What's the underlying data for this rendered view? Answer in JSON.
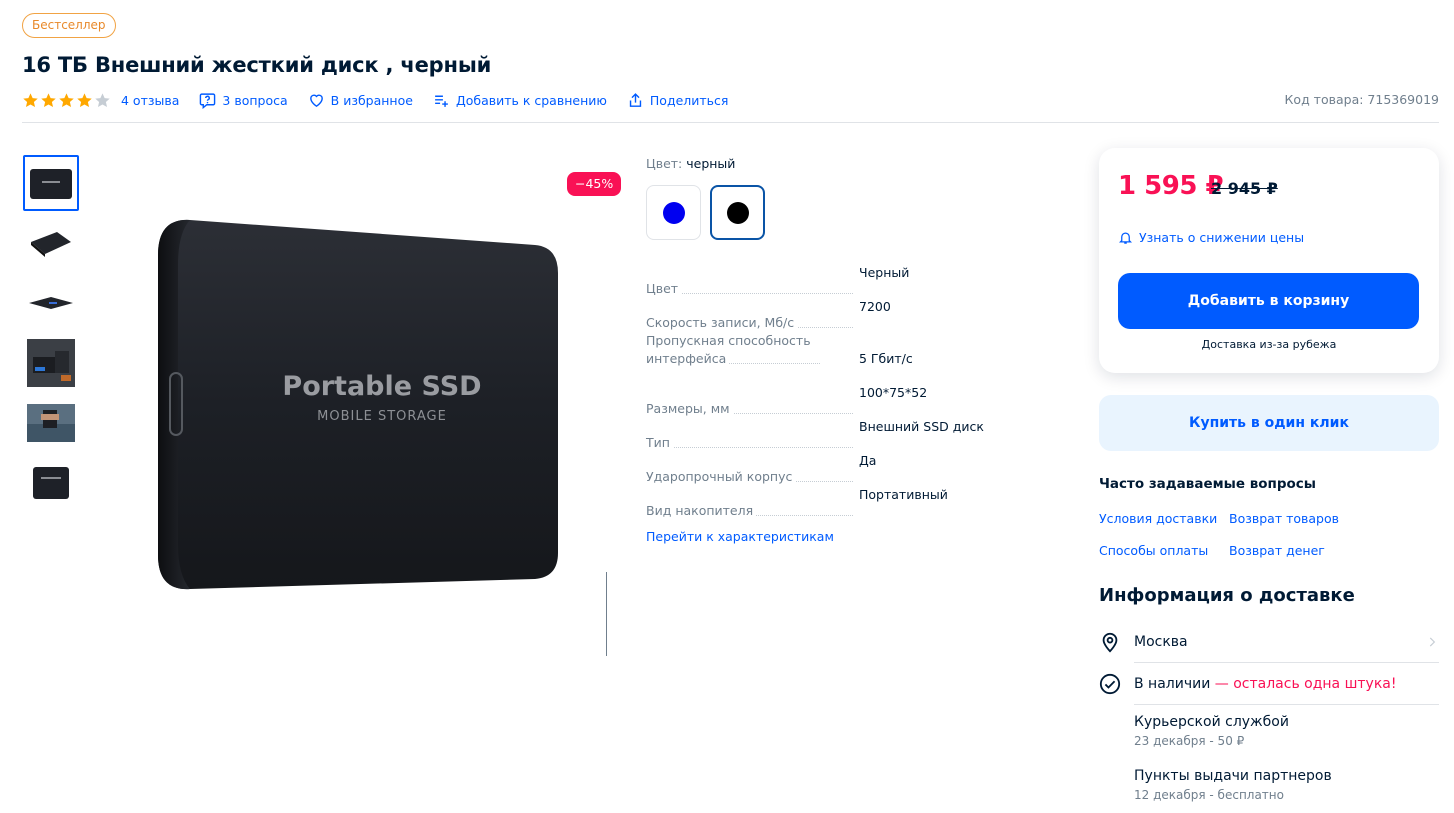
{
  "badge": "Бестселлер",
  "title": "16 ТБ Внешний жесткий диск , черный",
  "rating": {
    "stars": 4,
    "max": 5
  },
  "meta": {
    "reviews": "4 отзыва",
    "questions": "3 вопроса",
    "favorite": "В избранное",
    "compare": "Добавить к сравнению",
    "share": "Поделиться",
    "sku": "Код товара: 715369019"
  },
  "gallery": {
    "discount": "−45%",
    "product_text_line1": "Portable SSD",
    "product_text_line2": "MOBILE STORAGE"
  },
  "color": {
    "label": "Цвет:",
    "value": "черный",
    "options": [
      "#0000f0",
      "#000000"
    ]
  },
  "specs": [
    {
      "key": "Цвет",
      "value": "Черный"
    },
    {
      "key": "Скорость записи, Мб/с",
      "value": "7200"
    },
    {
      "key": "Пропускная способность интерфейса",
      "value": "5 Гбит/с"
    },
    {
      "key": "Размеры, мм",
      "value": "100*75*52"
    },
    {
      "key": "Тип",
      "value": "Внешний SSD диск"
    },
    {
      "key": "Ударопрочный корпус",
      "value": "Да"
    },
    {
      "key": "Вид накопителя",
      "value": "Портативный"
    }
  ],
  "to_specs": "Перейти к характеристикам",
  "price": {
    "current": "1 595 ₽",
    "old": "2 945 ₽",
    "notify": "Узнать о снижении цены",
    "cart": "Добавить в корзину",
    "abroad": "Доставка из-за рубежа",
    "one_click": "Купить в один клик"
  },
  "faq": {
    "title": "Часто задаваемые вопросы",
    "links": [
      "Условия доставки",
      "Возврат товаров",
      "Способы оплаты",
      "Возврат денег"
    ]
  },
  "delivery": {
    "title": "Информация о доставке",
    "city": "Москва",
    "stock": "В наличии",
    "stock_note": "— осталась одна штука!",
    "options": [
      {
        "name": "Курьерской службой",
        "sub": "23 декабря - 50 ₽"
      },
      {
        "name": "Пункты выдачи партнеров",
        "sub": "12 декабря - бесплатно"
      }
    ]
  },
  "colors": {
    "accent": "#005bff",
    "sale": "#f91155",
    "text": "#001a34",
    "muted": "#707f8d"
  }
}
